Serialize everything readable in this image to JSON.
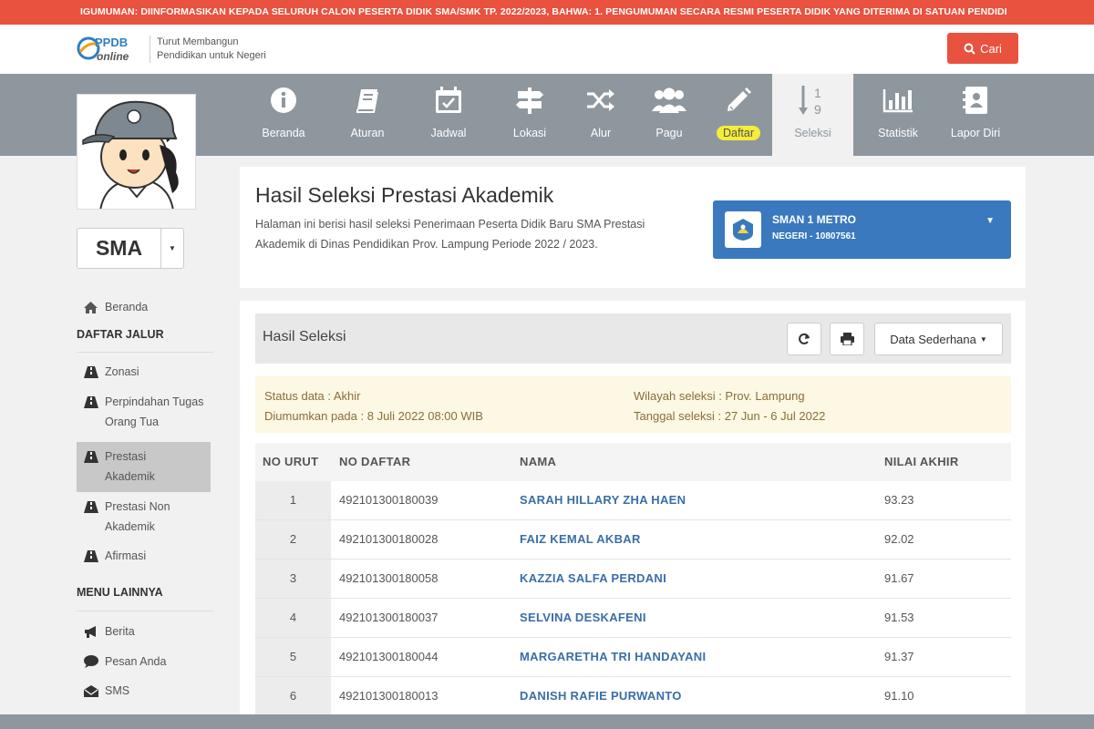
{
  "announcement": "IGUMUMAN: DIINFORMASIKAN KEPADA SELURUH CALON PESERTA DIDIK SMA/SMK TP. 2022/2023, BAHWA: 1. PENGUMUMAN SECARA RESMI PESERTA DIDIK YANG DITERIMA DI SATUAN PENDIDI",
  "header": {
    "logo_top": "PPDB",
    "logo_bottom": "online",
    "tagline_1": "Turut Membangun",
    "tagline_2": "Pendidikan untuk Negeri",
    "search_label": "Cari"
  },
  "nav": [
    {
      "label": "Beranda",
      "icon": "info-icon"
    },
    {
      "label": "Aturan",
      "icon": "book-icon"
    },
    {
      "label": "Jadwal",
      "icon": "calendar-check-icon"
    },
    {
      "label": "Lokasi",
      "icon": "signpost-icon"
    },
    {
      "label": "Alur",
      "icon": "shuffle-icon"
    },
    {
      "label": "Pagu",
      "icon": "users-icon"
    },
    {
      "label": "Daftar",
      "icon": "pencil-icon"
    },
    {
      "label": "Seleksi",
      "icon": "sort-numeric-icon",
      "glyph_top": "1",
      "glyph_bottom": "9"
    },
    {
      "label": "Statistik",
      "icon": "bar-chart-icon"
    },
    {
      "label": "Lapor Diri",
      "icon": "contact-book-icon"
    }
  ],
  "sidebar": {
    "level": "SMA",
    "home": "Beranda",
    "section_jalur": "DAFTAR JALUR",
    "jalur": [
      {
        "line1": "Zonasi",
        "line2": ""
      },
      {
        "line1": "Perpindahan Tugas",
        "line2": "Orang Tua"
      },
      {
        "line1": "Prestasi",
        "line2": "Akademik"
      },
      {
        "line1": "Prestasi Non",
        "line2": "Akademik"
      },
      {
        "line1": "Afirmasi",
        "line2": ""
      }
    ],
    "section_menu": "MENU LAINNYA",
    "menu": [
      "Berita",
      "Pesan Anda",
      "SMS"
    ]
  },
  "page": {
    "title": "Hasil Seleksi Prestasi Akademik",
    "description": "Halaman ini berisi hasil seleksi Penerimaan Peserta Didik Baru SMA Prestasi Akademik di Dinas Pendidikan Prov. Lampung Periode 2022 / 2023."
  },
  "school": {
    "name": "SMAN 1 METRO",
    "sub": "NEGERI - 10807561"
  },
  "panel": {
    "title": "Hasil Seleksi",
    "view_label": "Data Sederhana"
  },
  "info": {
    "status": "Status data : Akhir",
    "announced": "Diumumkan pada : 8 Juli 2022 08:00 WIB",
    "region": "Wilayah seleksi : Prov. Lampung",
    "date": "Tanggal seleksi : 27 Jun - 6 Jul 2022"
  },
  "table": {
    "headers": [
      "NO URUT",
      "NO DAFTAR",
      "NAMA",
      "NILAI AKHIR"
    ],
    "rows": [
      {
        "no": "1",
        "reg": "492101300180039",
        "name": "SARAH HILLARY ZHA HAEN",
        "score": "93.23"
      },
      {
        "no": "2",
        "reg": "492101300180028",
        "name": "FAIZ KEMAL AKBAR",
        "score": "92.02"
      },
      {
        "no": "3",
        "reg": "492101300180058",
        "name": "KAZZIA SALFA PERDANI",
        "score": "91.67"
      },
      {
        "no": "4",
        "reg": "492101300180037",
        "name": "SELVINA DESKAFENI",
        "score": "91.53"
      },
      {
        "no": "5",
        "reg": "492101300180044",
        "name": "MARGARETHA TRI HANDAYANI",
        "score": "91.37"
      },
      {
        "no": "6",
        "reg": "492101300180013",
        "name": "DANISH RAFIE PURWANTO",
        "score": "91.10"
      }
    ]
  }
}
